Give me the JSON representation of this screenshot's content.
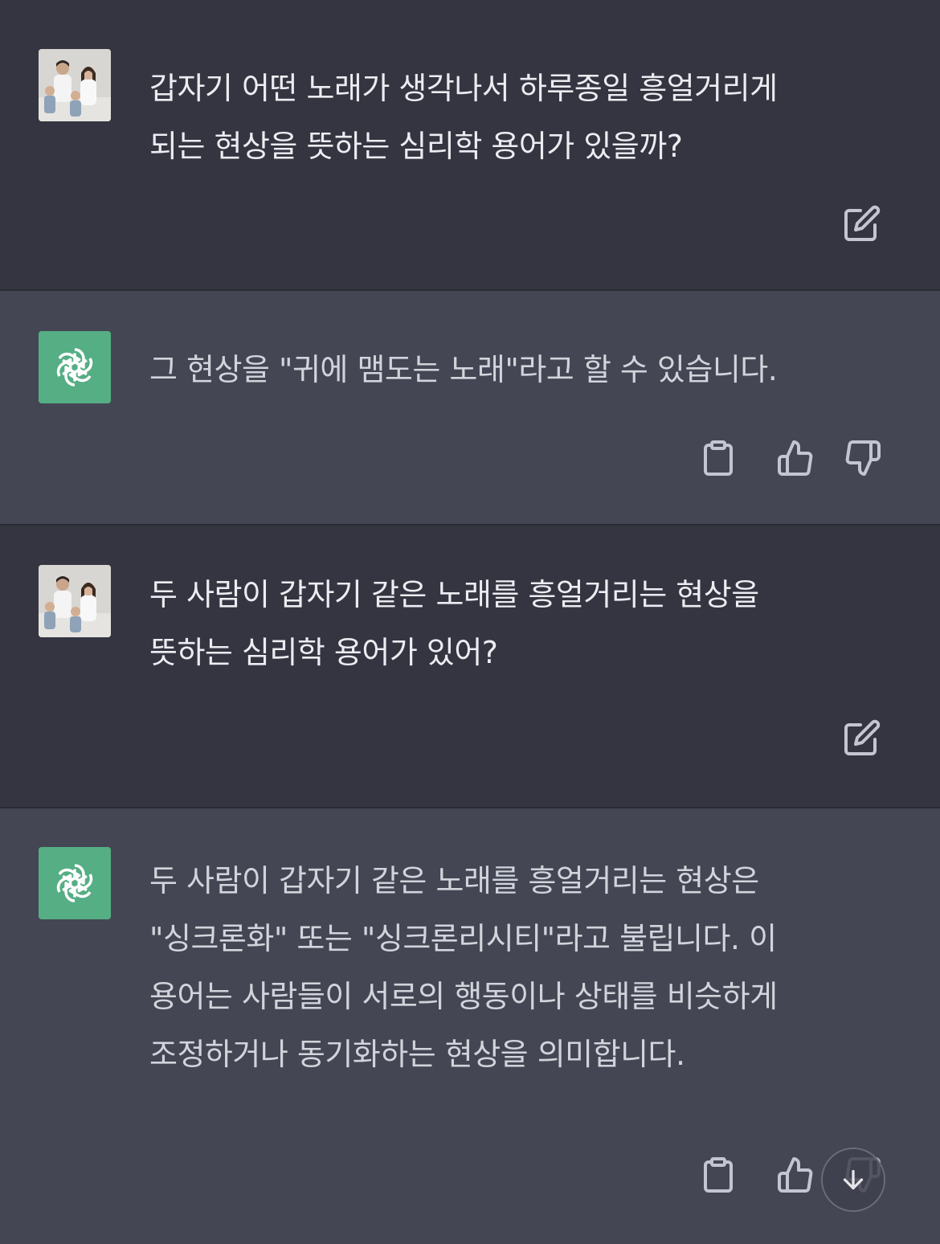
{
  "conversation": [
    {
      "role": "user",
      "text": "갑자기 어떤 노래가 생각나서 하루종일 흥얼거리게\n되는 현상을 뜻하는 심리학 용어가 있을까?"
    },
    {
      "role": "assistant",
      "text": "그 현상을 \"귀에 맴도는 노래\"라고 할 수 있습니다."
    },
    {
      "role": "user",
      "text": "두 사람이 갑자기 같은 노래를 흥얼거리는 현상을\n뜻하는 심리학 용어가 있어?"
    },
    {
      "role": "assistant",
      "text": "두 사람이 갑자기 같은 노래를 흥얼거리는 현상은\n\"싱크론화\" 또는 \"싱크론리시티\"라고 불립니다. 이\n용어는 사람들이 서로의 행동이나 상태를 비슷하게\n조정하거나 동기화하는 현상을 의미합니다."
    }
  ],
  "icons": {
    "user_avatar": "user-photo-avatar",
    "assistant_avatar": "openai-logo-icon",
    "edit": "edit-icon",
    "copy": "clipboard-icon",
    "like": "thumbs-up-icon",
    "dislike": "thumbs-down-icon",
    "scroll": "arrow-down-icon"
  },
  "colors": {
    "user_bg": "#343541",
    "assistant_bg": "#444654",
    "logo_bg": "#55ae84",
    "text": "#ececf1",
    "icon": "#c5c5d2"
  }
}
